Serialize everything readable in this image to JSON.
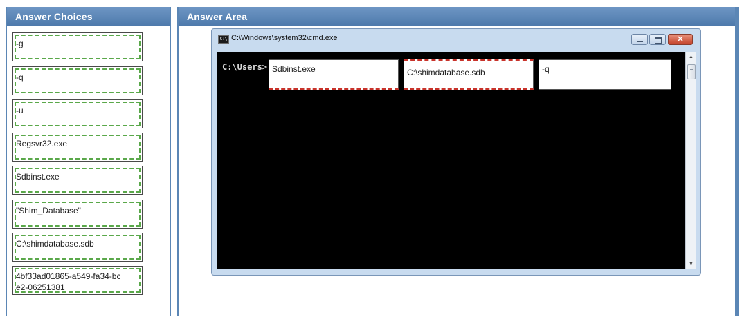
{
  "answer_choices": {
    "header": "Answer Choices",
    "items": [
      {
        "label": "-g"
      },
      {
        "label": "-q"
      },
      {
        "label": "-u"
      },
      {
        "label": "Regsvr32.exe"
      },
      {
        "label": "Sdbinst.exe"
      },
      {
        "label": "\"Shim_Database\""
      },
      {
        "label": "C:\\shimdatabase.sdb"
      },
      {
        "label": "4bf33ad01865-a549-fa34-bce2-06251381",
        "line1": "4bf33ad01865-a549-fa34-bc",
        "line2": "e2-06251381"
      }
    ]
  },
  "answer_area": {
    "header": "Answer Area",
    "cmd_window": {
      "title": "C:\\Windows\\system32\\cmd.exe",
      "icon_text": "C:\\",
      "close_label": "✕",
      "prompt": "C:\\Users>",
      "slots": [
        {
          "value": "Sdbinst.exe"
        },
        {
          "value": "C:\\shimdatabase.sdb"
        },
        {
          "value": "-q"
        }
      ]
    }
  },
  "colors": {
    "header_blue": "#5b86b5",
    "choice_dash": "#5aa84a",
    "slot_dash": "#c8322a",
    "console_bg": "#000000"
  },
  "icons": [
    "cmd-icon",
    "minimize-icon",
    "maximize-icon",
    "close-icon",
    "scroll-up-icon",
    "scroll-down-icon"
  ]
}
